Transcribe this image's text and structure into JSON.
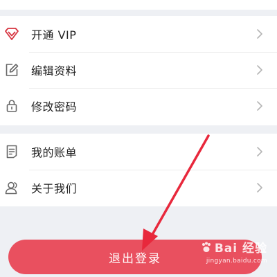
{
  "menu_group_1": [
    {
      "label": "开通 VIP",
      "icon": "diamond-icon"
    },
    {
      "label": "编辑资料",
      "icon": "edit-icon"
    },
    {
      "label": "修改密码",
      "icon": "lock-icon"
    }
  ],
  "menu_group_2": [
    {
      "label": "我的账单",
      "icon": "document-icon"
    },
    {
      "label": "关于我们",
      "icon": "people-icon"
    }
  ],
  "logout": {
    "label": "退出登录"
  },
  "watermark": {
    "brand": "Bai 经验",
    "url": "jingyan.baidu.com"
  },
  "colors": {
    "background": "#eef0f4",
    "logout_button": "#e9505f",
    "vip_icon": "#d6333f",
    "annotation_arrow": "#e8283c"
  }
}
